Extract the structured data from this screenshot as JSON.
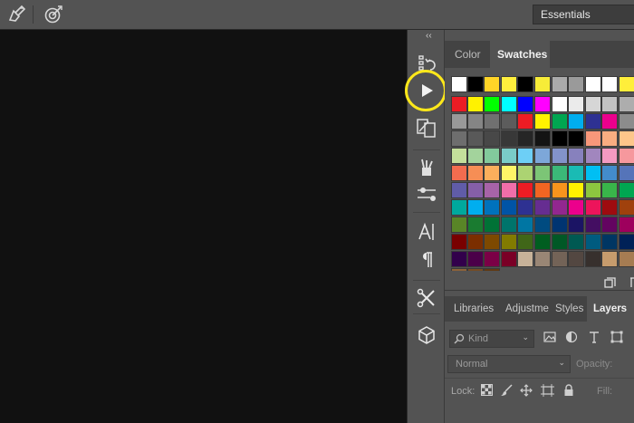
{
  "topbar": {
    "icons": [
      "brush-settings-icon",
      "target-adjust-icon"
    ],
    "workspace": "Essentials"
  },
  "toolstrip": {
    "collapse_glyph": "‹‹",
    "tools": [
      "history-icon",
      "play-action-icon",
      "properties-icon",
      "brushes-icon",
      "adjust-sliders-icon",
      "character-icon",
      "paragraph-icon",
      "tool-presets-icon",
      "3d-cube-icon"
    ],
    "highlighted_tool": "play-action-icon",
    "highlight_color": "#ffe81a"
  },
  "color_panel": {
    "tabs": [
      {
        "label": "Color",
        "active": false
      },
      {
        "label": "Swatches",
        "active": true
      }
    ],
    "footer_icons": [
      "new-swatch-icon",
      "delete-swatch-icon"
    ]
  },
  "swatch_rows": [
    [
      "#ffffff",
      "#000000",
      "#ffd427",
      "#ffef3d",
      "#000000",
      "#f7ec38",
      "#aaaaaa",
      "#9a9a9a",
      "#ffffff",
      "#ffffff",
      "#ffee3a"
    ],
    [
      "#ec1c24",
      "#fff200",
      "#00ff00",
      "#00ffff",
      "#0000ff",
      "#ff00ff",
      "#ffffff",
      "#ebebeb",
      "#d6d6d6",
      "#c2c2c2",
      "#adadad"
    ],
    [
      "#999999",
      "#858585",
      "#707070",
      "#5c5c5c",
      "#ed1c24",
      "#fff200",
      "#00a651",
      "#00aeef",
      "#2e3192",
      "#ec008c",
      "#8c8c8c"
    ],
    [
      "#6e6e6e",
      "#595959",
      "#484848",
      "#383838",
      "#262626",
      "#141414",
      "#000000",
      "#000000",
      "#f7977a",
      "#f9ad81",
      "#fdc68a"
    ],
    [
      "#c4df9b",
      "#a3d39c",
      "#82ca9c",
      "#7accc8",
      "#6dcff6",
      "#7da7d9",
      "#8393ca",
      "#8781bd",
      "#a186be",
      "#f49ac1",
      "#f6989d"
    ],
    [
      "#f26c4f",
      "#f68e55",
      "#fbaf5c",
      "#fff467",
      "#acd372",
      "#7cc576",
      "#3bb878",
      "#1abbb4",
      "#00bff3",
      "#438ccb",
      "#5574b9"
    ],
    [
      "#605ca8",
      "#855fa8",
      "#a763a8",
      "#f06ea9",
      "#ed1c24",
      "#f26522",
      "#f7941d",
      "#fff200",
      "#8dc63f",
      "#39b54a",
      "#00a651"
    ],
    [
      "#00a99d",
      "#00aeef",
      "#0072bc",
      "#0054a6",
      "#2e3192",
      "#662d91",
      "#92278f",
      "#ec008c",
      "#ed145b",
      "#9e0b0f",
      "#a0410d"
    ],
    [
      "#598527",
      "#1a7b30",
      "#007236",
      "#00746b",
      "#0076a3",
      "#004b80",
      "#003471",
      "#1b1464",
      "#440e62",
      "#630460",
      "#9e005d"
    ],
    [
      "#790000",
      "#7b2e00",
      "#7d4900",
      "#827b00",
      "#406618",
      "#005e20",
      "#005826",
      "#005952",
      "#005b7f",
      "#003663",
      "#002157"
    ],
    [
      "#32004b",
      "#4b0049",
      "#7b0046",
      "#7a0026",
      "#c7b299",
      "#998675",
      "#736357",
      "#534741",
      "#37302d",
      "#c69c6d",
      "#a67c52"
    ],
    [
      "#8c6239",
      "#754c24",
      "#603913"
    ]
  ],
  "layers_panel": {
    "tabs": [
      {
        "label": "Libraries",
        "active": false
      },
      {
        "label": "Adjustme",
        "active": false
      },
      {
        "label": "Styles",
        "active": false
      },
      {
        "label": "Layers",
        "active": true
      }
    ],
    "kind_label": "Kind",
    "filter_icons": [
      "image-filter-icon",
      "adjustment-filter-icon",
      "type-filter-icon",
      "shape-filter-icon"
    ],
    "blend_mode": "Normal",
    "opacity_label": "Opacity:",
    "lock_label": "Lock:",
    "lock_icons": [
      "lock-transparent-icon",
      "lock-image-icon",
      "lock-position-icon",
      "lock-artboard-icon",
      "lock-all-icon"
    ],
    "fill_label": "Fill:"
  }
}
